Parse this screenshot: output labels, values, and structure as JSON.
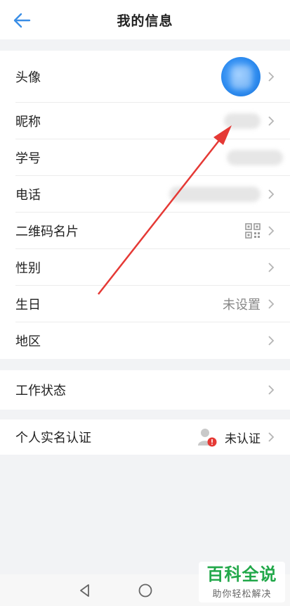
{
  "header": {
    "title": "我的信息"
  },
  "profile_rows": [
    {
      "label": "头像"
    },
    {
      "label": "昵称"
    },
    {
      "label": "学号"
    },
    {
      "label": "电话"
    },
    {
      "label": "二维码名片"
    },
    {
      "label": "性别"
    },
    {
      "label": "生日",
      "value": "未设置"
    },
    {
      "label": "地区"
    }
  ],
  "work": {
    "label": "工作状态"
  },
  "realname": {
    "label": "个人实名认证",
    "status": "未认证"
  },
  "watermark": {
    "title": "百科全说",
    "subtitle": "助你轻松解决"
  },
  "icons": {
    "back": "back-arrow-icon",
    "chevron": "chevron-right-icon",
    "qr": "qr-code-icon",
    "user_warning": "user-warning-icon",
    "nav_back": "triangle-back-icon",
    "nav_home": "circle-home-icon"
  },
  "colors": {
    "accent": "#3a8ee6",
    "arrow_annotation": "#e53935",
    "watermark_green": "#22a84a",
    "warning_red": "#e53935"
  }
}
